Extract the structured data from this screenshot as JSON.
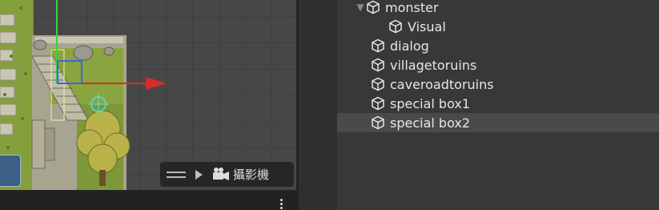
{
  "scene": {
    "camera_label": "攝影機",
    "icons": [
      "drag-handle-icon",
      "play-icon",
      "camera-icon",
      "kebab-menu-icon"
    ]
  },
  "hierarchy": {
    "items": [
      {
        "label": "monster",
        "expanded": true,
        "depth": 0
      },
      {
        "label": "Visual",
        "depth": 1
      },
      {
        "label": "dialog",
        "depth": 0
      },
      {
        "label": "villagetoruins",
        "depth": 0
      },
      {
        "label": "caveroadtoruins",
        "depth": 0
      },
      {
        "label": "special box1",
        "depth": 0
      },
      {
        "label": "special box2",
        "depth": 0,
        "selected": true
      }
    ]
  },
  "colors": {
    "background": "#383838",
    "selection": "#4a4a4a",
    "gizmo_x": "#d62b2b",
    "gizmo_y": "#39d33a",
    "gizmo_z": "#3a66e0"
  }
}
